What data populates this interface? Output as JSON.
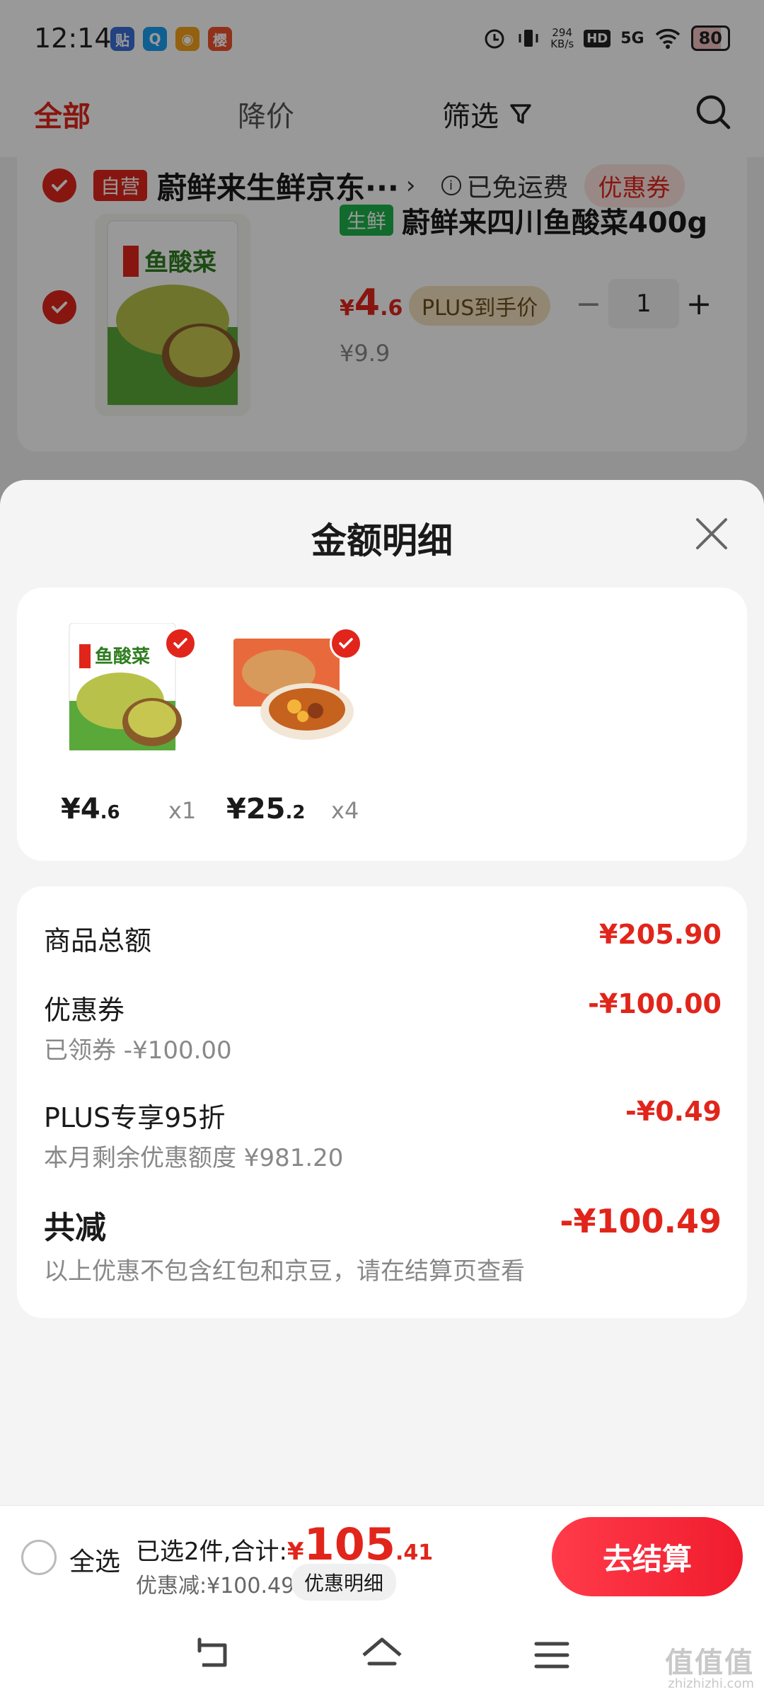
{
  "status_bar": {
    "time": "12:14",
    "apps": [
      {
        "label": "贴",
        "color": "#3b6fd8"
      },
      {
        "label": "Q",
        "color": "#1aa0f0"
      },
      {
        "label": "◉",
        "color": "#f6a21a"
      },
      {
        "label": "樱",
        "color": "#f0522e"
      }
    ],
    "net_speed_value": "294",
    "net_speed_unit": "KB/s",
    "hd": "HD",
    "signal": "5G",
    "battery": "80"
  },
  "top_nav": {
    "tab_all": "全部",
    "tab_price_drop": "降价",
    "tab_filter": "筛选"
  },
  "store": {
    "badge": "自营",
    "name": "蔚鲜来生鲜京东···",
    "arrow": "›",
    "free_shipping": "已免运费",
    "coupon": "优惠券"
  },
  "cart_item": {
    "tag": "生鲜",
    "title": "蔚鲜来四川鱼酸菜400g",
    "currency": "¥",
    "price_int": "4",
    "price_dec": ".6",
    "plus_label": "PLUS到手价",
    "quantity": "1",
    "original_price": "¥9.9",
    "minus": "−",
    "plus": "+"
  },
  "sheet": {
    "title": "金额明细",
    "products": [
      {
        "price_int": "¥4",
        "price_dec": ".6",
        "qty": "x1",
        "image": "pickled-vegetable-pack"
      },
      {
        "price_int": "¥25",
        "price_dec": ".2",
        "qty": "x4",
        "image": "braised-chicken-box"
      }
    ],
    "rows": {
      "subtotal_label": "商品总额",
      "subtotal_value": "¥205.90",
      "coupon_label": "优惠券",
      "coupon_sub": "已领券 -¥100.00",
      "coupon_value": "-¥100.00",
      "plus_label": "PLUS专享95折",
      "plus_sub": "本月剩余优惠额度 ¥981.20",
      "plus_value": "-¥0.49",
      "total_label": "共减",
      "total_sub": "以上优惠不包含红包和京豆，请在结算页查看",
      "total_value": "-¥100.49"
    }
  },
  "footer": {
    "select_all": "全选",
    "selected_prefix": "已选2件,合计:",
    "currency": "¥",
    "total_int": "105",
    "total_dec": ".41",
    "discount": "优惠减:¥100.49",
    "detail_button": "优惠明细",
    "checkout": "去结算"
  },
  "watermark": {
    "main": "值值值",
    "sub": "zhizhizhi.com"
  },
  "colors": {
    "accent_red": "#e1251b",
    "checkout_gradient": "#ff3b4a",
    "fresh_green": "#1db34a",
    "plus_gold": "#f3e2bf"
  }
}
